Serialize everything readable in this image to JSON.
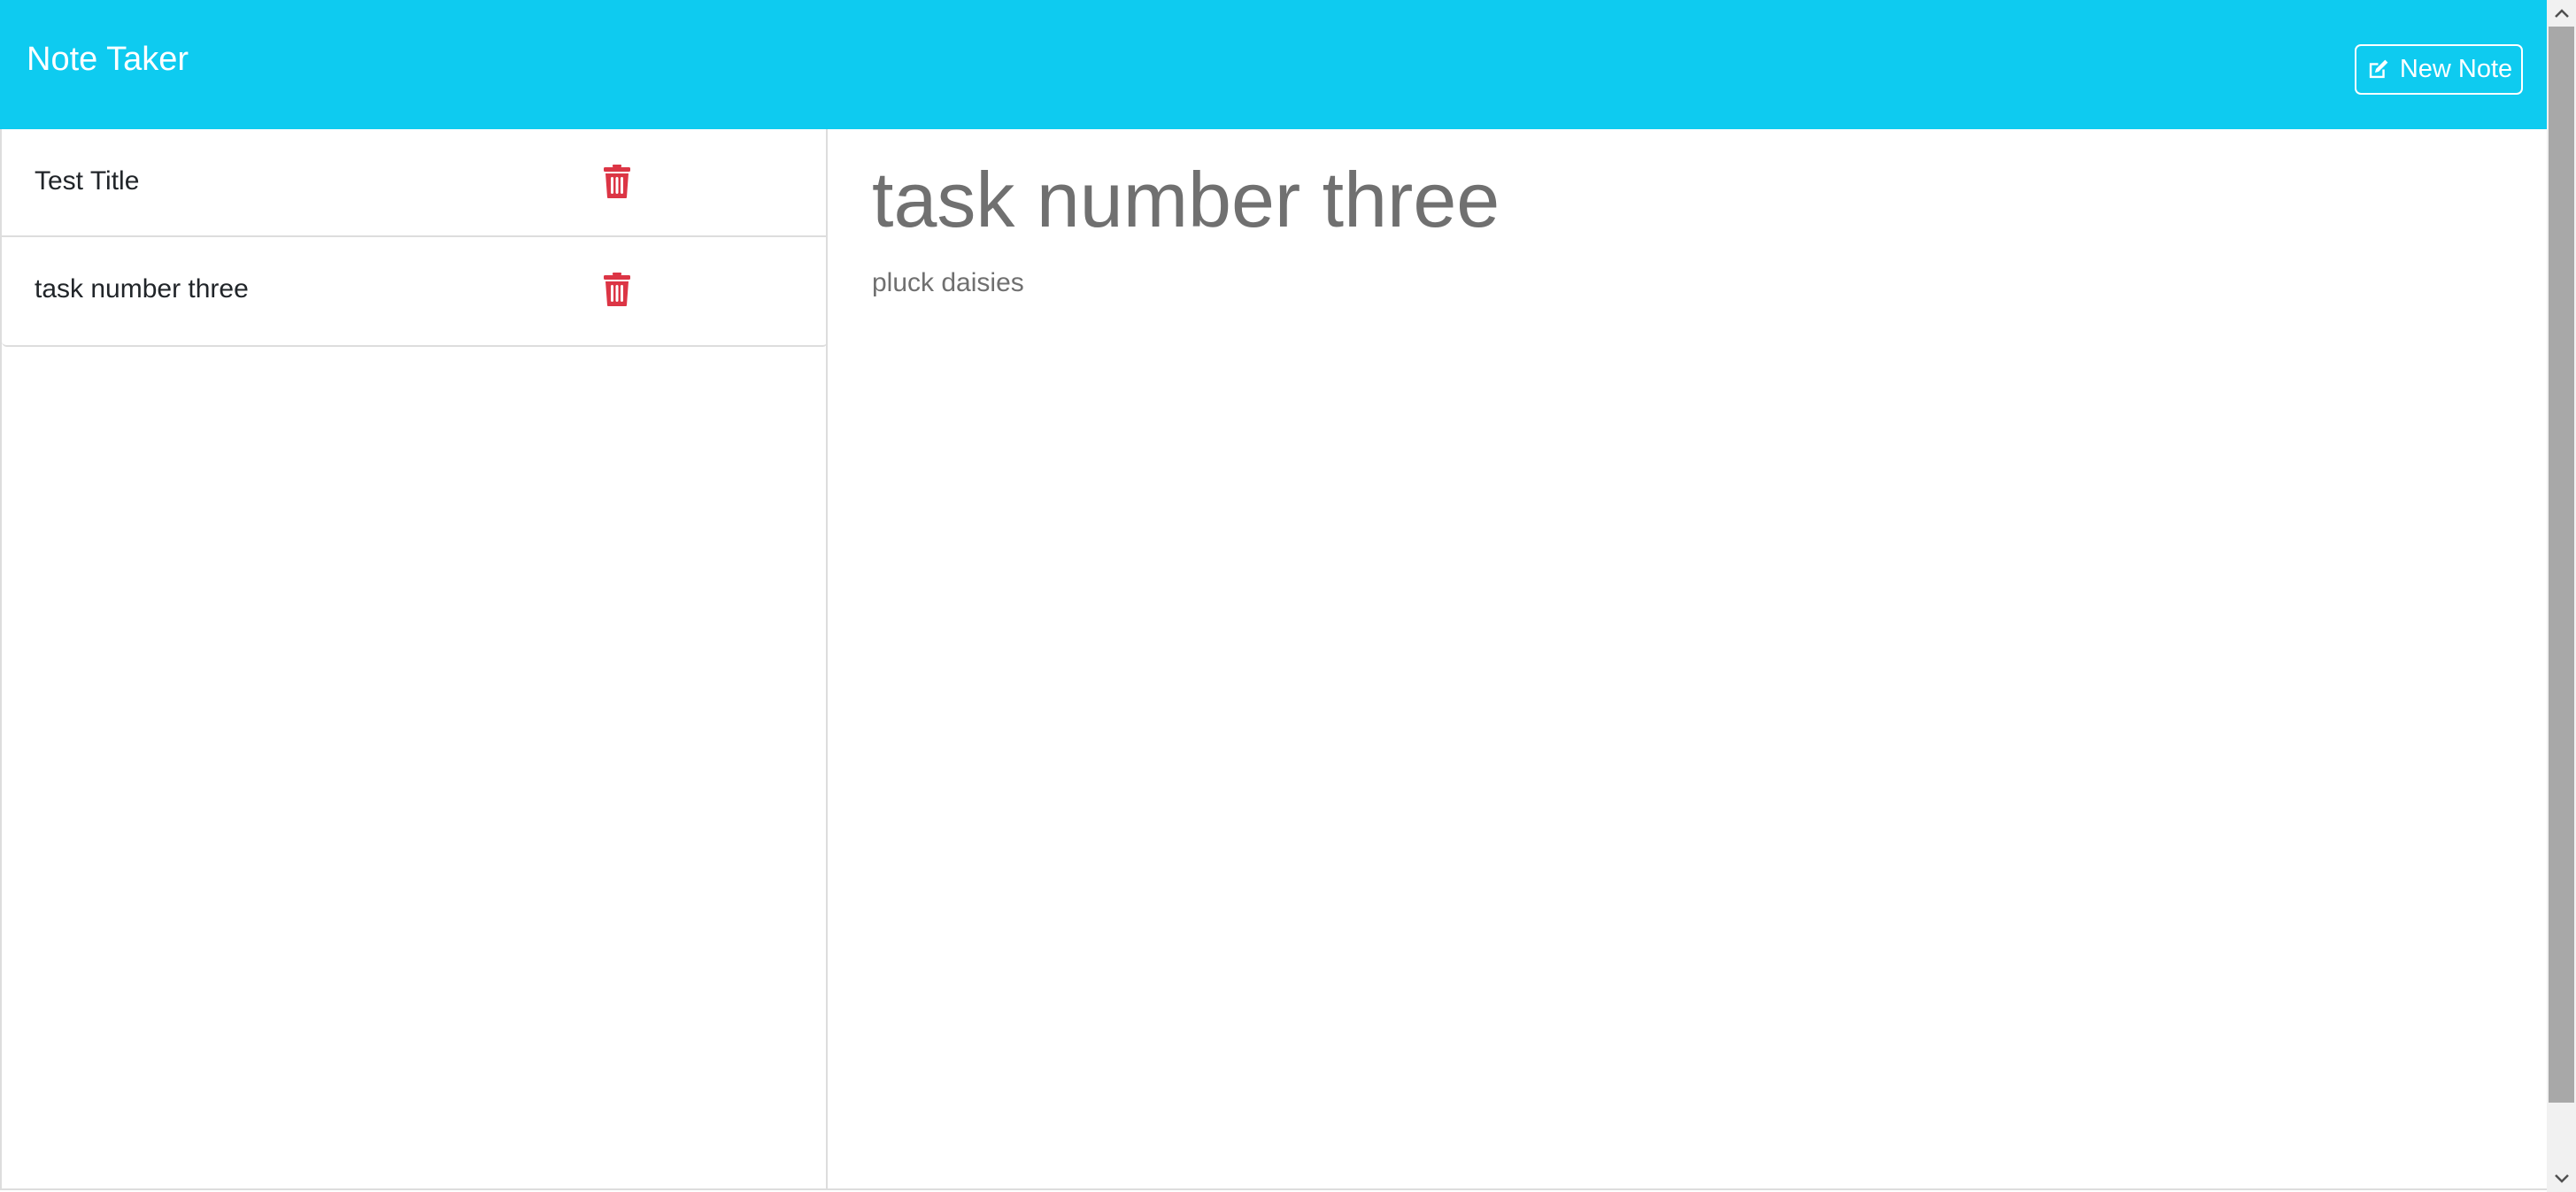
{
  "app": {
    "title": "Note Taker"
  },
  "toolbar": {
    "new_note_label": "New Note",
    "new_note_icon": "pencil-square-icon"
  },
  "sidebar": {
    "notes": [
      {
        "title": "Test Title",
        "delete_icon": "trash-icon"
      },
      {
        "title": "task number three",
        "delete_icon": "trash-icon"
      }
    ]
  },
  "editor": {
    "title": "task number three",
    "text": "pluck daisies"
  },
  "colors": {
    "navbar": "#0ecbf0",
    "delete": "#dc3545",
    "editor_text": "#707070"
  }
}
